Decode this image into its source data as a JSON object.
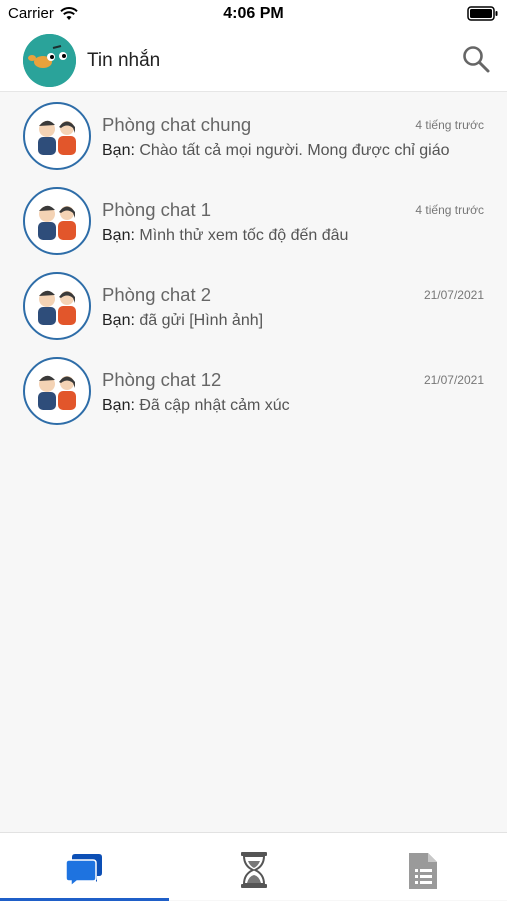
{
  "status_bar": {
    "carrier": "Carrier",
    "time": "4:06 PM"
  },
  "header": {
    "title": "Tin nhắn",
    "avatar_icon": "bird-avatar-icon",
    "search_icon": "search-icon"
  },
  "chats": [
    {
      "name": "Phòng chat chung",
      "time": "4 tiếng trước",
      "sender": "Bạn:",
      "message": "Chào tất cả mọi người. Mong được chỉ giáo"
    },
    {
      "name": "Phòng chat 1",
      "time": "4 tiếng trước",
      "sender": "Bạn:",
      "message": "Mình thử xem tốc độ đến đâu"
    },
    {
      "name": "Phòng chat 2",
      "time": "21/07/2021",
      "sender": "Bạn:",
      "message": "đã gửi [Hình ảnh]"
    },
    {
      "name": "Phòng chat 12",
      "time": "21/07/2021",
      "sender": "Bạn:",
      "message": "Đã cập nhật cảm xúc"
    }
  ],
  "tabs": [
    {
      "icon": "chat-bubbles-icon",
      "active": true
    },
    {
      "icon": "hourglass-icon",
      "active": false
    },
    {
      "icon": "document-icon",
      "active": false
    }
  ],
  "colors": {
    "accent": "#1f5fc8",
    "avatar_border": "#2e6da8",
    "header_avatar_bg": "#2aa39a"
  }
}
